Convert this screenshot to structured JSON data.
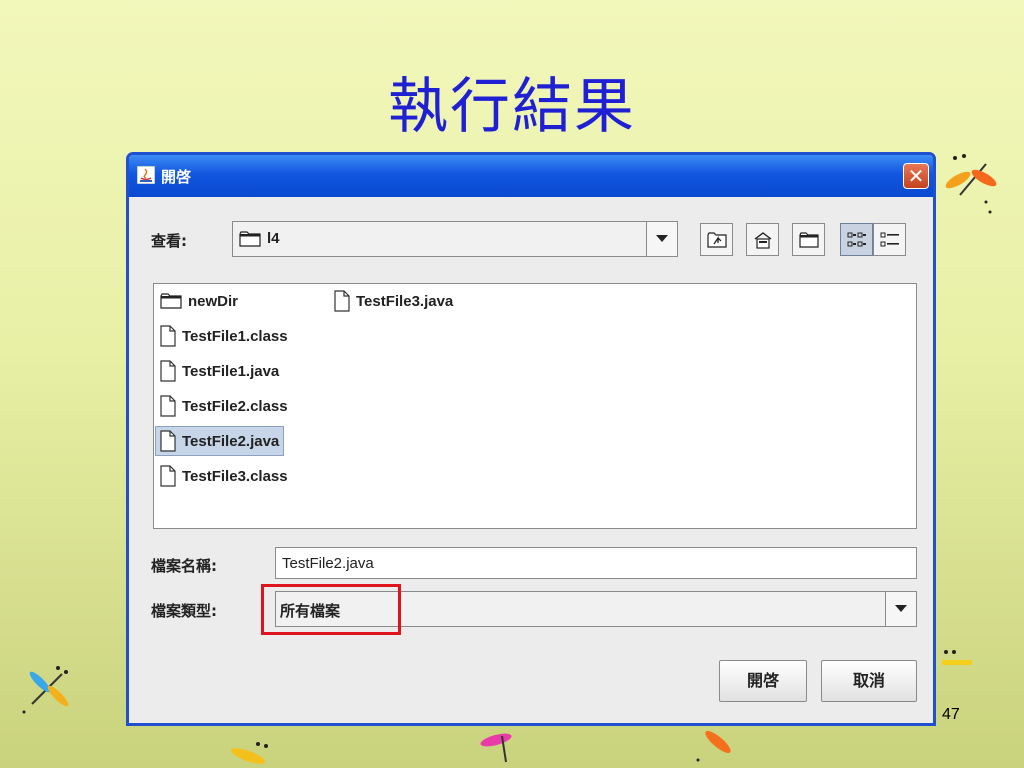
{
  "slide": {
    "title": "執行結果",
    "page_number": "47"
  },
  "dialog": {
    "title": "開啓",
    "close_glyph": "✕",
    "look_in": {
      "label": "查看:",
      "value": "l4"
    },
    "files": [
      {
        "name": "newDir",
        "type": "folder",
        "selected": false
      },
      {
        "name": "TestFile1.class",
        "type": "file",
        "selected": false
      },
      {
        "name": "TestFile1.java",
        "type": "file",
        "selected": false
      },
      {
        "name": "TestFile2.class",
        "type": "file",
        "selected": false
      },
      {
        "name": "TestFile2.java",
        "type": "file",
        "selected": true
      },
      {
        "name": "TestFile3.class",
        "type": "file",
        "selected": false
      },
      {
        "name": "TestFile3.java",
        "type": "file",
        "selected": false
      }
    ],
    "filename": {
      "label": "檔案名稱:",
      "value": "TestFile2.java"
    },
    "filetype": {
      "label": "檔案類型:",
      "value": "所有檔案"
    },
    "buttons": {
      "open": "開啓",
      "cancel": "取消"
    }
  },
  "colors": {
    "title_text": "#1f1fd4",
    "titlebar": "#0b49cf",
    "highlight": "#e0141e",
    "selection": "#c7d5e8"
  },
  "icons": [
    "java-app-icon",
    "close-icon",
    "folder-icon",
    "file-icon",
    "up-folder-icon",
    "home-icon",
    "new-folder-icon",
    "list-view-icon",
    "details-view-icon",
    "dropdown-arrow-icon"
  ]
}
